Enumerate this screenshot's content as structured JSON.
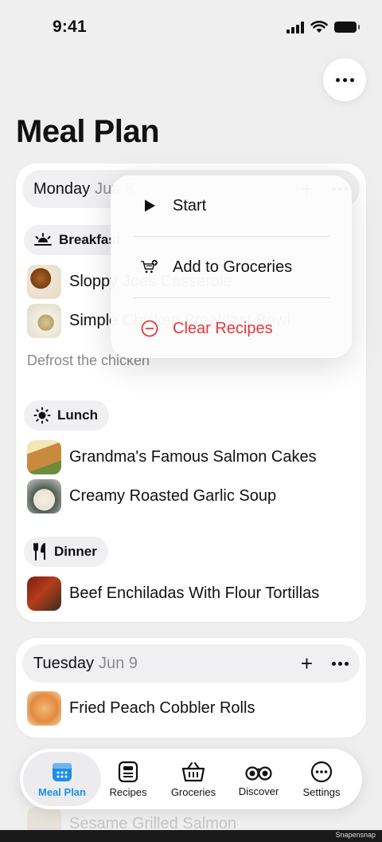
{
  "status_bar": {
    "time": "9:41"
  },
  "page": {
    "title": "Meal Plan"
  },
  "days": [
    {
      "name": "Monday",
      "date": "Jun 8",
      "meals": [
        {
          "name": "Breakfast",
          "icon": "sunrise-icon",
          "recipes": [
            "Sloppy Joes Casserole",
            "Simple Chicken Breakfast Bowl"
          ],
          "note": "Defrost the chicken"
        },
        {
          "name": "Lunch",
          "icon": "sun-icon",
          "recipes": [
            "Grandma's Famous Salmon Cakes",
            "Creamy Roasted Garlic Soup"
          ]
        },
        {
          "name": "Dinner",
          "icon": "fork-knife-icon",
          "recipes": [
            "Beef Enchiladas With Flour Tortillas"
          ]
        }
      ]
    },
    {
      "name": "Tuesday",
      "date": "Jun 9",
      "recipes": [
        "Fried Peach Cobbler Rolls",
        "Sesame Grilled Salmon"
      ]
    }
  ],
  "context_menu": {
    "items": [
      {
        "label": "Start",
        "icon": "play-icon"
      },
      {
        "label": "Add to Groceries",
        "icon": "cart-plus-icon"
      },
      {
        "label": "Clear Recipes",
        "icon": "minus-circle-icon",
        "destructive": true
      }
    ]
  },
  "tab_bar": {
    "active": "Meal Plan",
    "tabs": [
      {
        "label": "Meal Plan",
        "icon": "calendar-icon"
      },
      {
        "label": "Recipes",
        "icon": "recipe-card-icon"
      },
      {
        "label": "Groceries",
        "icon": "basket-icon"
      },
      {
        "label": "Discover",
        "icon": "binoculars-icon"
      },
      {
        "label": "Settings",
        "icon": "ellipsis-circle-icon"
      }
    ]
  },
  "watermark": "Snapensnap",
  "colors": {
    "accent": "#1e8ee8",
    "destructive": "#e5373d",
    "secondary_text": "#8a8a8e",
    "background": "#efefef"
  }
}
